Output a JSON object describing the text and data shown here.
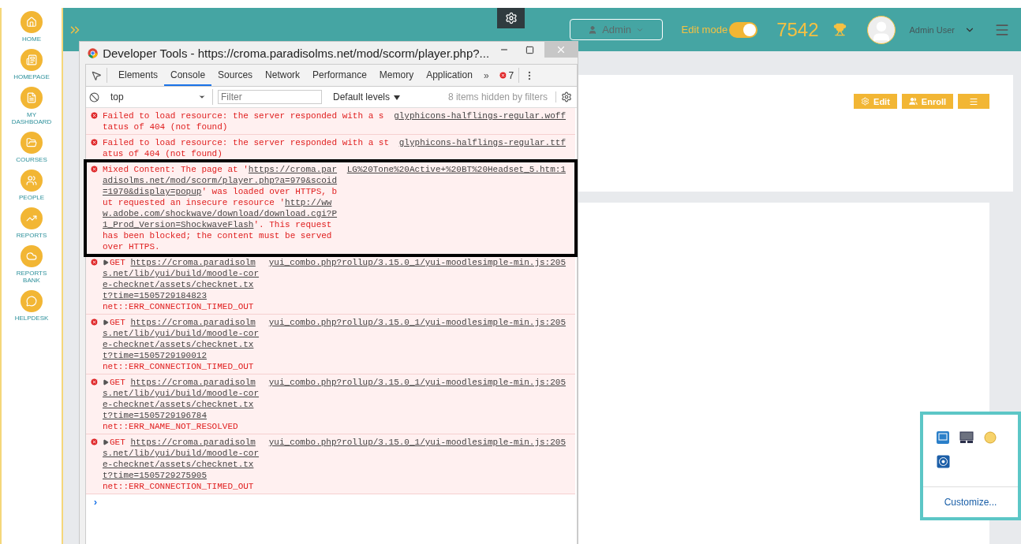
{
  "sidebar": {
    "items": [
      {
        "label": "HOME"
      },
      {
        "label": "HOMEPAGE"
      },
      {
        "label": "MY DASHBOARD"
      },
      {
        "label": "COURSES"
      },
      {
        "label": "PEOPLE"
      },
      {
        "label": "REPORTS"
      },
      {
        "label": "REPORTS BANK"
      },
      {
        "label": "HELPDESK"
      }
    ]
  },
  "header": {
    "role_button": "Admin",
    "edit_mode": {
      "label": "Edit mode",
      "on": true
    },
    "points": "7542",
    "user_name": "Admin User"
  },
  "card_buttons": [
    {
      "kind": "edit",
      "label": "Edit"
    },
    {
      "kind": "enroll",
      "label": "Enroll"
    },
    {
      "kind": "menu"
    }
  ],
  "devtools": {
    "title": "Developer Tools - https://croma.paradisolms.net/mod/scorm/player.php?...",
    "tabs": [
      {
        "label": "Elements",
        "selected": false
      },
      {
        "label": "Console",
        "selected": true
      },
      {
        "label": "Sources",
        "selected": false
      },
      {
        "label": "Network",
        "selected": false
      },
      {
        "label": "Performance",
        "selected": false
      },
      {
        "label": "Memory",
        "selected": false
      },
      {
        "label": "Application",
        "selected": false
      }
    ],
    "more_tabs": "»",
    "error_count": "7",
    "context": "top",
    "filter_placeholder": "Filter",
    "levels": "Default levels",
    "hidden_note": "8 items hidden by filters",
    "messages": [
      {
        "kind": "error",
        "text": "Failed to load resource: the server responded with a status of 404 (not found)",
        "source": "glyphicons-halflings-regular.woff"
      },
      {
        "kind": "error",
        "text": "Failed to load resource: the server responded with a status of 404 (not found)",
        "source": "glyphicons-halflings-regular.ttf"
      },
      {
        "kind": "mixed",
        "highlighted": true,
        "before": "Mixed Content: The page at '",
        "page_url": "https://croma.paradisolms.net/mod/scorm/player.php?a=979&scoid=1970&display=popup",
        "middle": "' was loaded over HTTPS, but requested an insecure resource '",
        "resource_url": "http://www.adobe.com/shockwave/download/download.cgi?P1_Prod_Version=ShockwaveFlash",
        "after": "'. This request has been blocked; the content must be served over HTTPS.",
        "source": "LG%20Tone%20Active+%20BT%20Headset_5.htm:1"
      },
      {
        "kind": "request",
        "method": "GET",
        "url": "https://croma.paradisolms.net/lib/yui/build/moodle-core-checknet/assets/checknet.txt?time=1505729184823",
        "source": "yui_combo.php?rollup/3.15.0_1/yui-moodlesimple-min.js:205",
        "error": "net::ERR_CONNECTION_TIMED_OUT"
      },
      {
        "kind": "request",
        "method": "GET",
        "url": "https://croma.paradisolms.net/lib/yui/build/moodle-core-checknet/assets/checknet.txt?time=1505729190012",
        "source": "yui_combo.php?rollup/3.15.0_1/yui-moodlesimple-min.js:205",
        "error": "net::ERR_CONNECTION_TIMED_OUT"
      },
      {
        "kind": "request",
        "method": "GET",
        "url": "https://croma.paradisolms.net/lib/yui/build/moodle-core-checknet/assets/checknet.txt?time=1505729196784",
        "source": "yui_combo.php?rollup/3.15.0_1/yui-moodlesimple-min.js:205",
        "error": "net::ERR_NAME_NOT_RESOLVED"
      },
      {
        "kind": "request",
        "method": "GET",
        "url": "https://croma.paradisolms.net/lib/yui/build/moodle-core-checknet/assets/checknet.txt?time=1505729275905",
        "source": "yui_combo.php?rollup/3.15.0_1/yui-moodlesimple-min.js:205",
        "error": "net::ERR_CONNECTION_TIMED_OUT"
      }
    ],
    "prompt": "›"
  },
  "tray": {
    "customize": "Customize..."
  }
}
